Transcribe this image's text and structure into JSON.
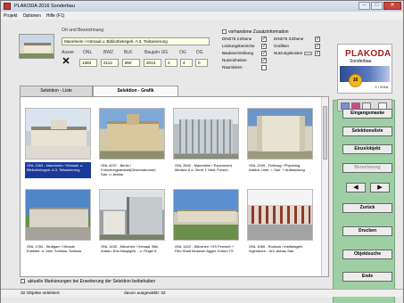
{
  "window": {
    "title": "PLAKODA 2016 Sonderbau",
    "min": "–",
    "max": "□",
    "close": "✕"
  },
  "menu": [
    "Projekt",
    "Optionen",
    "Hilfe (F1)"
  ],
  "header": {
    "location_label": "Ort und Bezeichnung",
    "location_value": "Mannheim / Hörsaal u. Bibliotheksgeb. A 3, Teilsanierung",
    "columns": [
      "Auswr.",
      "ONL",
      "BWZ",
      "BLK",
      "Baujahr UG",
      "OG",
      "DG"
    ],
    "values": [
      "1383",
      "2112",
      "BW",
      "2013",
      "2",
      "4",
      "0"
    ],
    "x_mark": "✕",
    "extra_heading": "vorhandene Zusatzinformation",
    "extras_col1": [
      "DIN276 2.Ebene",
      "Leistungsbereiche",
      "Baubeschreibung",
      "Nutzeinheiten",
      "Raumlisten"
    ],
    "extras_col2": [
      "DIN276 3.Ebene",
      "Grafiken",
      "Nutzungskosten"
    ]
  },
  "logo": {
    "name": "PLAKODA",
    "subtitle": "Sonderbau",
    "badge": "16",
    "date": "1 / 2016"
  },
  "tabs": {
    "list": "Selektion - Liste",
    "graphic": "Selektion - Grafik"
  },
  "buttons": {
    "eingangsmaske": "Eingangsmaske",
    "selektionsliste": "Selektionsliste",
    "einzelobjekt": "Einzelobjekt",
    "berechnung": "Berechnung",
    "prev": "◀",
    "next": "▶",
    "zurueck": "Zurück",
    "drucken": "Drucken",
    "objektsuche": "Objektsuche",
    "ende": "Ende"
  },
  "cards": [
    {
      "caption": "ONL 1383 - Mannheim / Hörsaal- u. Bibliotheksgeb. A 3, Teilsanierung"
    },
    {
      "caption": "ONL 6237 - Berlin / Forschungsanstalt(Observatorium) San. u. Anbau"
    },
    {
      "caption": "ONL 2642 - Mannheim / Experiment. Medizin 6 d. Zentr. f. Med. Forsch"
    },
    {
      "caption": "ONL 2299 - Freiburg / Physiolog Institut, Umb. + San. + Aufstockung"
    },
    {
      "caption": "ONL 1784 - Stuttgart / Hörsale Erweiter. d. Univ. Schloss, Schloss"
    },
    {
      "caption": "ONL 1430 - München / Hörsaal. Bibl. Anbau. Erw.Hauptgeb. - u. Flügel A"
    },
    {
      "caption": "ONL 1422 - München / HS Fernseh + Film Stadt Museum Agget. Komm TS"
    },
    {
      "caption": "ONL 1065 - Rostock / Institutsgeb. Ingenieure - Uni. Anbau San"
    }
  ],
  "footer": {
    "retain_label": "aktuelle Markierungen bei Erweiterung der Selektion beibehalten",
    "selected_count": "32 Objekte selektiert",
    "chosen_count": "davon ausgewählt: 32"
  },
  "colors": {
    "panel_green": "#9ecfa4",
    "selection_blue": "#1a3a9a",
    "logo_red": "#a11f1f",
    "badge_yellow": "#f3b51c"
  }
}
